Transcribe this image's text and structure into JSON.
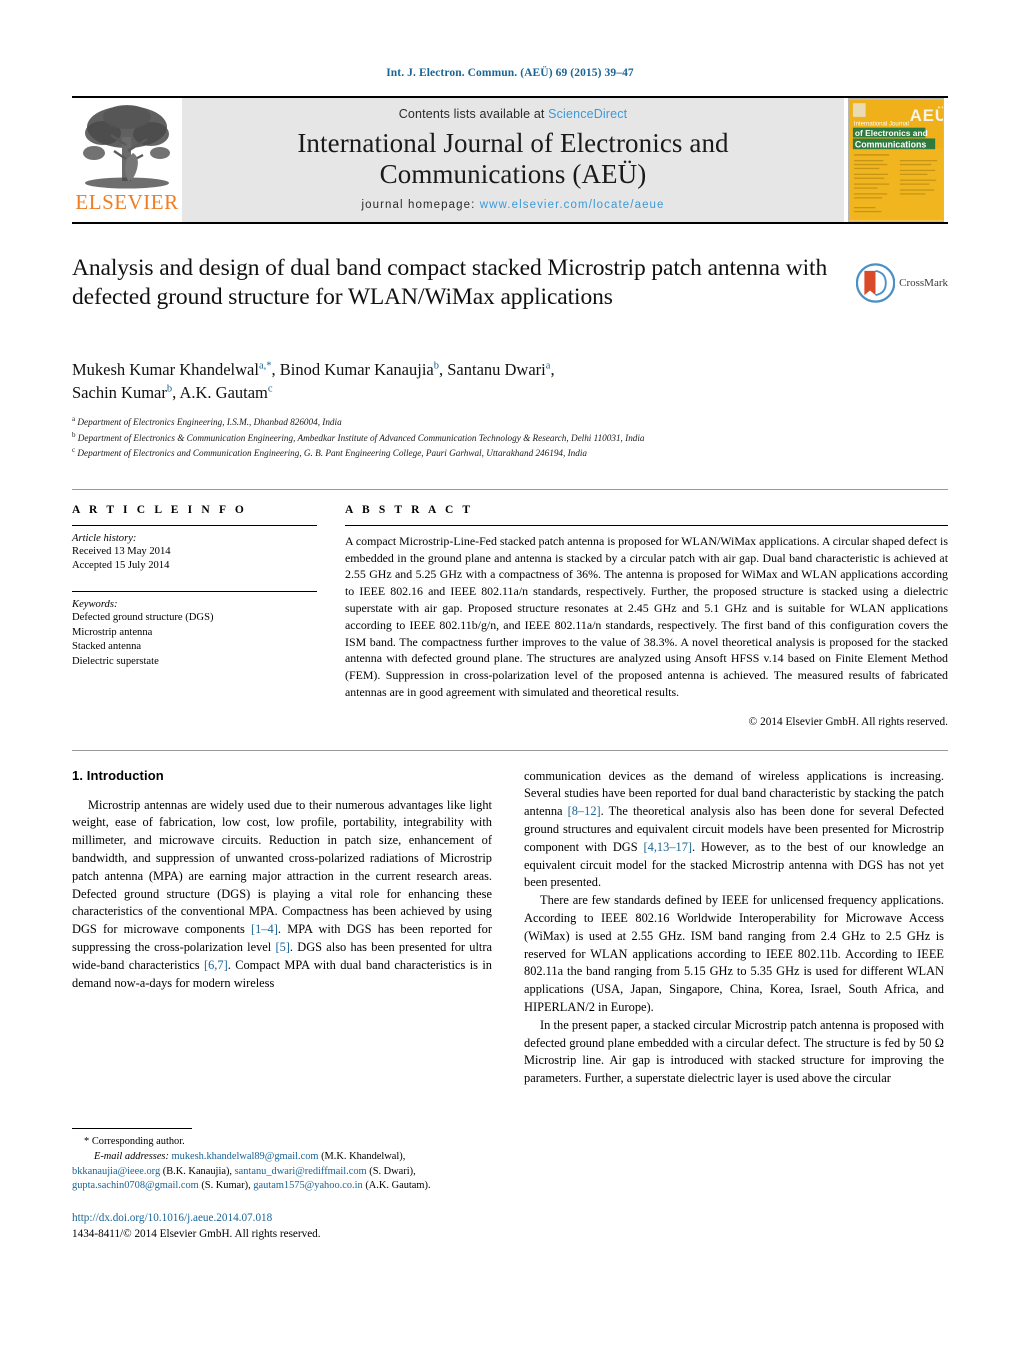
{
  "running_head": "Int. J. Electron. Commun. (AEÜ) 69 (2015) 39–47",
  "masthead": {
    "publisher_name": "ELSEVIER",
    "contents_prefix": "Contents lists available at ",
    "contents_link": "ScienceDirect",
    "journal_title_line1": "International Journal of Electronics and",
    "journal_title_line2": "Communications (AEÜ)",
    "homepage_label": "journal homepage: ",
    "homepage_url": "www.elsevier.com/locate/aeue",
    "cover_title_line1": "International Journal",
    "cover_title_line2": "of Electronics and",
    "cover_title_line3": "Communications",
    "cover_badge": "AEÜ",
    "accent_link_color": "#3a9ad9",
    "elsevier_orange": "#ef7d22"
  },
  "article": {
    "title": "Analysis and design of dual band compact stacked Microstrip patch antenna with defected ground structure for WLAN/WiMax applications",
    "crossmark_label": "CrossMark",
    "authors_line1_parts": [
      {
        "name": "Mukesh Kumar Khandelwal",
        "sup": "a,*"
      },
      {
        "name": "Binod Kumar Kanaujia",
        "sup": "b"
      },
      {
        "name": "Santanu Dwari",
        "sup": "a"
      }
    ],
    "authors_line2_parts": [
      {
        "name": "Sachin Kumar",
        "sup": "b"
      },
      {
        "name": "A.K. Gautam",
        "sup": "c"
      }
    ],
    "affiliations": [
      {
        "mark": "a",
        "text": "Department of Electronics Engineering, I.S.M., Dhanbad 826004, India"
      },
      {
        "mark": "b",
        "text": "Department of Electronics & Communication Engineering, Ambedkar Institute of Advanced Communication Technology & Research, Delhi 110031, India"
      },
      {
        "mark": "c",
        "text": "Department of Electronics and Communication Engineering, G. B. Pant Engineering College, Pauri Garhwal, Uttarakhand 246194, India"
      }
    ]
  },
  "article_info": {
    "heading": "A R T I C L E   I N F O",
    "history_label": "Article history:",
    "received": "Received 13 May 2014",
    "accepted": "Accepted 15 July 2014",
    "keywords_label": "Keywords:",
    "keywords": [
      "Defected ground structure (DGS)",
      "Microstrip antenna",
      "Stacked antenna",
      "Dielectric superstate"
    ]
  },
  "abstract": {
    "heading": "A B S T R A C T",
    "text": "A compact Microstrip-Line-Fed stacked patch antenna is proposed for WLAN/WiMax applications. A circular shaped defect is embedded in the ground plane and antenna is stacked by a circular patch with air gap. Dual band characteristic is achieved at 2.55 GHz and 5.25 GHz with a compactness of 36%. The antenna is proposed for WiMax and WLAN applications according to IEEE 802.16 and IEEE 802.11a/n standards, respectively. Further, the proposed structure is stacked using a dielectric superstate with air gap. Proposed structure resonates at 2.45 GHz and 5.1 GHz and is suitable for WLAN applications according to IEEE 802.11b/g/n, and IEEE 802.11a/n standards, respectively. The first band of this configuration covers the ISM band. The compactness further improves to the value of 38.3%. A novel theoretical analysis is proposed for the stacked antenna with defected ground plane. The structures are analyzed using Ansoft HFSS v.14 based on Finite Element Method (FEM). Suppression in cross-polarization level of the proposed antenna is achieved. The measured results of fabricated antennas are in good agreement with simulated and theoretical results.",
    "copyright": "© 2014 Elsevier GmbH. All rights reserved."
  },
  "body": {
    "section_number_title": "1.  Introduction",
    "left_para1_a": "Microstrip antennas are widely used due to their numerous advantages like light weight, ease of fabrication, low cost, low profile, portability, integrability with millimeter, and microwave circuits. Reduction in patch size, enhancement of bandwidth, and suppression of unwanted cross-polarized radiations of Microstrip patch antenna (MPA) are earning major attraction in the current research areas. Defected ground structure (DGS) is playing a vital role for enhancing these characteristics of the conventional MPA. Compactness has been achieved by using DGS for microwave components ",
    "left_ref1": "[1–4]",
    "left_para1_b": ". MPA with DGS has been reported for suppressing the cross-polarization level ",
    "left_ref2": "[5]",
    "left_para1_c": ". DGS also has been presented for ultra wide-band characteristics ",
    "left_ref3": "[6,7]",
    "left_para1_d": ". Compact MPA with dual band characteristics is in demand now-a-days for modern wireless",
    "right_para1_a": "communication devices as the demand of wireless applications is increasing. Several studies have been reported for dual band characteristic by stacking the patch antenna ",
    "right_ref1": "[8–12]",
    "right_para1_b": ". The theoretical analysis also has been done for several Defected ground structures and equivalent circuit models have been presented for Microstrip component with DGS ",
    "right_ref2": "[4,13–17]",
    "right_para1_c": ". However, as to the best of our knowledge an equivalent circuit model for the stacked Microstrip antenna with DGS has not yet been presented.",
    "right_para2": "There are few standards defined by IEEE for unlicensed frequency applications. According to IEEE 802.16 Worldwide Interoperability for Microwave Access (WiMax) is used at 2.55 GHz. ISM band ranging from 2.4 GHz to 2.5 GHz is reserved for WLAN applications according to IEEE 802.11b. According to IEEE 802.11a the band ranging from 5.15 GHz to 5.35 GHz is used for different WLAN applications (USA, Japan, Singapore, China, Korea, Israel, South Africa, and HIPERLAN/2 in Europe).",
    "right_para3": "In the present paper, a stacked circular Microstrip patch antenna is proposed with defected ground plane embedded with a circular defect. The structure is fed by 50 Ω Microstrip line. Air gap is introduced with stacked structure for improving the parameters. Further, a superstate dielectric layer is used above the circular"
  },
  "footnote": {
    "corresponding_marker": "*",
    "corresponding_label": "Corresponding author.",
    "email_label": "E-mail addresses:",
    "emails": [
      {
        "address": "mukesh.khandelwal89@gmail.com",
        "owner": "(M.K. Khandelwal),"
      },
      {
        "address": "bkkanaujia@ieee.org",
        "owner": "(B.K. Kanaujia),"
      },
      {
        "address": "santanu_dwari@rediffmail.com",
        "owner": "(S. Dwari),"
      },
      {
        "address": "gupta.sachin0708@gmail.com",
        "owner": "(S. Kumar),"
      },
      {
        "address": "gautam1575@yahoo.co.in",
        "owner": "(A.K. Gautam)."
      }
    ],
    "doi": "http://dx.doi.org/10.1016/j.aeue.2014.07.018",
    "issn_line": "1434-8411/© 2014 Elsevier GmbH. All rights reserved."
  }
}
